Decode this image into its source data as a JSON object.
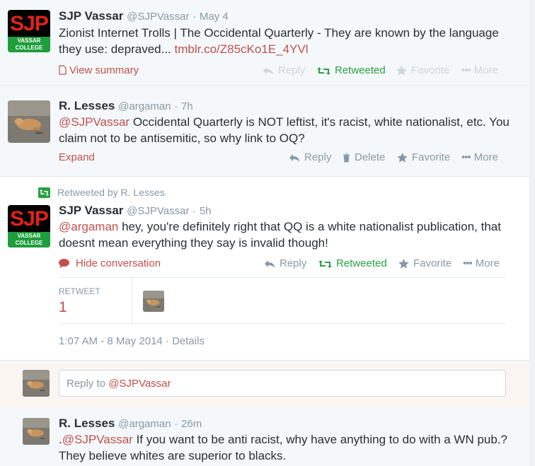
{
  "tweets": [
    {
      "name": "SJP Vassar",
      "handle": "@SJPVassar",
      "time": "May 4",
      "text": "Zionist Internet Trolls | The Occidental Quarterly - They are known by the language they use: depraved...",
      "link": "tmblr.co/Z85cKo1E_4YVl",
      "expand_label": "View summary",
      "actions": {
        "reply": "Reply",
        "retweet": "Retweeted",
        "favorite": "Favorite",
        "more": "More"
      }
    },
    {
      "name": "R. Lesses",
      "handle": "@argaman",
      "time": "7h",
      "mention": "@SJPVassar",
      "text": "Occidental Quarterly is NOT leftist, it's racist, white nationalist, etc. You claim not to be antisemitic, so why link to OQ?",
      "expand_label": "Expand",
      "actions": {
        "reply": "Reply",
        "delete": "Delete",
        "favorite": "Favorite",
        "more": "More"
      }
    },
    {
      "retweeted_by": "Retweeted by R. Lesses",
      "name": "SJP Vassar",
      "handle": "@SJPVassar",
      "time": "5h",
      "mention": "@argaman",
      "text": "hey, you're definitely right that QQ is a white nationalist publication, that doesnt mean everything they say is invalid though!",
      "expand_label": "Hide conversation",
      "actions": {
        "reply": "Reply",
        "retweet": "Retweeted",
        "favorite": "Favorite",
        "more": "More"
      },
      "stats": {
        "label": "RETWEET",
        "value": "1"
      },
      "timestamp": "1:07 AM - 8 May 2014",
      "details": "Details"
    },
    {
      "name": "R. Lesses",
      "handle": "@argaman",
      "time": "26m",
      "prefix": ".",
      "mention": "@SJPVassar",
      "text": "If you want to be anti racist, why have anything to do with a WN pub.? They believe whites are superior to blacks."
    }
  ],
  "reply_box": {
    "prefix": "Reply to ",
    "mention": "@SJPVassar"
  },
  "avatar_sjp": {
    "logo": "SJP",
    "line1": "VASSAR",
    "line2": "COLLEGE"
  },
  "colors": {
    "accent": "#c0504d",
    "retweet_green": "#2aa043",
    "muted": "#8899a6"
  }
}
